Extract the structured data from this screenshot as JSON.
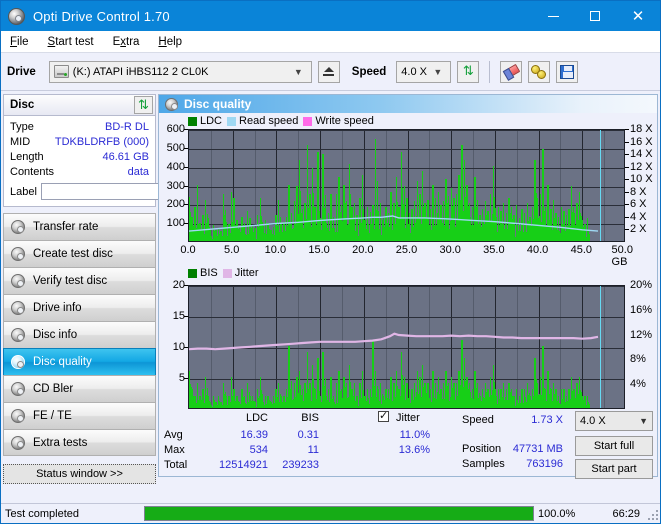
{
  "window": {
    "title": "Opti Drive Control 1.70",
    "icon": "disc-icon",
    "minimize": "−",
    "maximize": "□",
    "close": "✕"
  },
  "menu": [
    {
      "label": "File",
      "accel": "F"
    },
    {
      "label": "Start test",
      "accel": "S"
    },
    {
      "label": "Extra",
      "accel": "x"
    },
    {
      "label": "Help",
      "accel": "H"
    }
  ],
  "toolbar": {
    "drive_label": "Drive",
    "drive_value": "(K:)  ATAPI iHBS112  2 CL0K",
    "drive_icon": "drive-icon",
    "eject_icon": "eject-icon",
    "speed_label": "Speed",
    "speed_value": "4.0 X",
    "refresh_icon": "refresh-icon",
    "eraser_icon": "eraser-icon",
    "keys_icon": "keys-icon",
    "save_icon": "save-floppy-icon"
  },
  "disc_panel": {
    "header": "Disc",
    "refresh_icon": "refresh-icon",
    "rows": [
      {
        "key": "Type",
        "value": "BD-R DL"
      },
      {
        "key": "MID",
        "value": "TDKBLDRFB (000)"
      },
      {
        "key": "Length",
        "value": "46.61 GB"
      },
      {
        "key": "Contents",
        "value": "data"
      }
    ],
    "label_key": "Label",
    "label_value": "",
    "label_placeholder": "",
    "disc_button_icon": "cd-icon"
  },
  "nav": {
    "items": [
      {
        "label": "Transfer rate",
        "icon": "disc-icon",
        "selected": false
      },
      {
        "label": "Create test disc",
        "icon": "disc-icon",
        "selected": false
      },
      {
        "label": "Verify test disc",
        "icon": "disc-icon",
        "selected": false
      },
      {
        "label": "Drive info",
        "icon": "disc-icon",
        "selected": false
      },
      {
        "label": "Disc info",
        "icon": "disc-icon",
        "selected": false
      },
      {
        "label": "Disc quality",
        "icon": "disc-icon",
        "selected": true
      },
      {
        "label": "CD Bler",
        "icon": "disc-icon",
        "selected": false
      },
      {
        "label": "FE / TE",
        "icon": "disc-icon",
        "selected": false
      },
      {
        "label": "Extra tests",
        "icon": "disc-icon",
        "selected": false
      }
    ],
    "status_window": "Status window >>"
  },
  "panel": {
    "title": "Disc quality",
    "icon": "disc-icon"
  },
  "stats": {
    "col_ldc": "LDC",
    "col_bis": "BIS",
    "jitter_label": "Jitter",
    "jitter_checked": true,
    "rows": [
      {
        "name": "Avg",
        "ldc": "16.39",
        "bis": "0.31",
        "jitter": "11.0%"
      },
      {
        "name": "Max",
        "ldc": "534",
        "bis": "11",
        "jitter": "13.6%"
      },
      {
        "name": "Total",
        "ldc": "12514921",
        "bis": "239233",
        "jitter": ""
      }
    ],
    "speed_label": "Speed",
    "speed_value": "1.73 X",
    "position_label": "Position",
    "position_value": "47731 MB",
    "samples_label": "Samples",
    "samples_value": "763196",
    "speed_select": "4.0 X",
    "start_full": "Start full",
    "start_part": "Start part"
  },
  "statusbar": {
    "message": "Test completed",
    "progress_percent": 100,
    "progress_text": "100.0%",
    "elapsed": "66:29"
  },
  "colors": {
    "accent": "#0a84d8",
    "ldc_green": "#17cf17",
    "read_speed": "#9fd8f2",
    "write_speed": "#ff6be8",
    "jitter_pink": "#e0b6e6",
    "plot_bg": "#6b7285",
    "progress_green": "#16ac16",
    "value_blue": "#2b2bd4"
  },
  "chart_data": [
    {
      "type": "bar",
      "name": "disc-quality-ldc-chart",
      "title": "",
      "xlabel": "GB",
      "ylabel": "LDC",
      "xlim": [
        0,
        50
      ],
      "ylim": [
        0,
        600
      ],
      "y2lim": [
        0,
        18
      ],
      "y2label": "X",
      "grid": true,
      "legend_position": "top-left",
      "legend": [
        {
          "name": "LDC",
          "color": "#008000"
        },
        {
          "name": "Read speed",
          "color": "#9fd8f2"
        },
        {
          "name": "Write speed",
          "color": "#ff6be8"
        }
      ],
      "xticks": [
        "0.0",
        "5.0",
        "10.0",
        "15.0",
        "20.0",
        "25.0",
        "30.0",
        "35.0",
        "40.0",
        "45.0",
        "50.0 GB"
      ],
      "yticks": [
        "100",
        "200",
        "300",
        "400",
        "500",
        "600"
      ],
      "y2ticks": [
        "2 X",
        "4 X",
        "6 X",
        "8 X",
        "10 X",
        "12 X",
        "14 X",
        "16 X",
        "18 X"
      ],
      "data_end_gb": 47.0,
      "series": [
        {
          "name": "LDC",
          "color": "#17cf17",
          "kind": "bars",
          "x": [
            0.0,
            0.3,
            0.6,
            0.9,
            1.2,
            1.5,
            1.8,
            2.1,
            2.4,
            2.7,
            3.0,
            3.3,
            3.6,
            3.9,
            4.2,
            4.5,
            4.8,
            5.1,
            5.4,
            5.7,
            6.0,
            6.3,
            6.6,
            6.9,
            7.2,
            7.5,
            7.8,
            8.1,
            8.4,
            8.7,
            9.0,
            9.3,
            9.6,
            9.9,
            10.2,
            10.5,
            10.8,
            11.1,
            11.4,
            11.7,
            12.0,
            12.3,
            12.6,
            12.9,
            13.2,
            13.5,
            13.8,
            14.1,
            14.4,
            14.7,
            15.0,
            15.3,
            15.6,
            15.9,
            16.2,
            16.5,
            16.8,
            17.1,
            17.4,
            17.7,
            18.0,
            18.3,
            18.6,
            18.9,
            19.2,
            19.5,
            19.8,
            20.1,
            20.4,
            20.7,
            21.0,
            21.3,
            21.6,
            21.9,
            22.2,
            22.5,
            22.8,
            23.1,
            23.4,
            23.7,
            24.0,
            24.3,
            24.6,
            24.9,
            25.2,
            25.5,
            25.8,
            26.1,
            26.4,
            26.7,
            27.0,
            27.3,
            27.6,
            27.9,
            28.2,
            28.5,
            28.8,
            29.1,
            29.4,
            29.7,
            30.0,
            30.3,
            30.6,
            30.9,
            31.2,
            31.5,
            31.8,
            32.1,
            32.4,
            32.7,
            33.0,
            33.3,
            33.6,
            33.9,
            34.2,
            34.5,
            34.8,
            35.1,
            35.4,
            35.7,
            36.0,
            36.3,
            36.6,
            36.9,
            37.2,
            37.5,
            37.8,
            38.1,
            38.4,
            38.7,
            39.0,
            39.3,
            39.6,
            39.9,
            40.2,
            40.5,
            40.8,
            41.1,
            41.4,
            41.7,
            42.0,
            42.3,
            42.6,
            42.9,
            43.2,
            43.5,
            43.8,
            44.1,
            44.4,
            44.7,
            45.0,
            45.3,
            45.6,
            45.9,
            46.2,
            46.5,
            46.8
          ],
          "values": [
            235,
            130,
            180,
            300,
            95,
            140,
            220,
            120,
            65,
            85,
            60,
            70,
            55,
            250,
            100,
            90,
            260,
            230,
            110,
            75,
            130,
            95,
            160,
            120,
            85,
            70,
            140,
            230,
            80,
            110,
            95,
            60,
            75,
            140,
            220,
            90,
            100,
            130,
            300,
            150,
            210,
            290,
            430,
            170,
            200,
            510,
            250,
            390,
            180,
            470,
            120,
            460,
            200,
            150,
            250,
            130,
            250,
            340,
            190,
            300,
            210,
            410,
            180,
            200,
            140,
            230,
            350,
            110,
            180,
            155,
            190,
            540,
            160,
            200,
            120,
            180,
            150,
            260,
            200,
            340,
            180,
            470,
            290,
            230,
            150,
            170,
            210,
            320,
            250,
            370,
            200,
            220,
            170,
            300,
            230,
            260,
            190,
            210,
            330,
            240,
            280,
            230,
            250,
            350,
            510,
            430,
            300,
            200,
            180,
            340,
            220,
            140,
            170,
            210,
            160,
            250,
            400,
            130,
            180,
            160,
            200,
            150,
            230,
            180,
            140,
            190,
            120,
            170,
            150,
            200,
            130,
            180,
            430,
            230,
            250,
            490,
            180,
            300,
            170,
            220,
            150,
            130,
            180,
            160,
            140,
            170,
            290,
            150,
            200,
            260,
            110,
            90,
            120
          ],
          "note": "Per-sample LDC error counts across the recorded area (0 to 47 GB)"
        },
        {
          "name": "Read speed",
          "color": "#9fd8f2",
          "kind": "line",
          "axis": "right",
          "x": [
            0.0,
            2.5,
            5.0,
            7.5,
            10.0,
            12.5,
            15.0,
            17.5,
            20.0,
            21.0,
            22.0,
            23.3,
            24.0,
            25.0,
            27.0,
            30.0,
            32.5,
            35.0,
            37.5,
            40.0,
            42.5,
            45.0,
            46.8
          ],
          "values": [
            1.9,
            2.2,
            2.5,
            2.8,
            3.1,
            3.3,
            3.6,
            3.8,
            4.0,
            4.1,
            4.1,
            4.3,
            4.0,
            4.0,
            4.0,
            3.8,
            3.6,
            3.4,
            3.1,
            2.8,
            2.5,
            2.1,
            1.9
          ],
          "note": "Read speed in X, right axis"
        },
        {
          "name": "Write speed",
          "color": "#ff6be8",
          "kind": "line",
          "axis": "right",
          "x": [],
          "values": []
        }
      ]
    },
    {
      "type": "bar",
      "name": "disc-quality-bis-jitter-chart",
      "title": "",
      "xlabel": "GB",
      "ylabel": "BIS",
      "xlim": [
        0,
        50
      ],
      "ylim": [
        0,
        20
      ],
      "y2lim": [
        0,
        20
      ],
      "y2label": "%",
      "grid": true,
      "legend_position": "top-left",
      "legend": [
        {
          "name": "BIS",
          "color": "#008000"
        },
        {
          "name": "Jitter",
          "color": "#e0b6e6"
        }
      ],
      "xticks": [
        "0.0",
        "5.0",
        "10.0",
        "15.0",
        "20.0",
        "25.0",
        "30.0",
        "35.0",
        "40.0",
        "45.0",
        "50.0 GB"
      ],
      "yticks": [
        "5",
        "10",
        "15",
        "20"
      ],
      "y2ticks": [
        "4%",
        "8%",
        "12%",
        "16%",
        "20%"
      ],
      "data_end_gb": 47.0,
      "series": [
        {
          "name": "BIS",
          "color": "#17cf17",
          "kind": "bars",
          "x": [
            0.0,
            0.3,
            0.6,
            0.9,
            1.2,
            1.5,
            1.8,
            2.1,
            2.4,
            2.7,
            3.0,
            3.3,
            3.6,
            3.9,
            4.2,
            4.5,
            4.8,
            5.1,
            5.4,
            5.7,
            6.0,
            6.3,
            6.6,
            6.9,
            7.2,
            7.5,
            7.8,
            8.1,
            8.4,
            8.7,
            9.0,
            9.3,
            9.6,
            9.9,
            10.2,
            10.5,
            10.8,
            11.1,
            11.4,
            11.7,
            12.0,
            12.3,
            12.6,
            12.9,
            13.2,
            13.5,
            13.8,
            14.1,
            14.4,
            14.7,
            15.0,
            15.3,
            15.6,
            15.9,
            16.2,
            16.5,
            16.8,
            17.1,
            17.4,
            17.7,
            18.0,
            18.3,
            18.6,
            18.9,
            19.2,
            19.5,
            19.8,
            20.1,
            20.4,
            20.7,
            21.0,
            21.3,
            21.6,
            21.9,
            22.2,
            22.5,
            22.8,
            23.1,
            23.4,
            23.7,
            24.0,
            24.3,
            24.6,
            24.9,
            25.2,
            25.5,
            25.8,
            26.1,
            26.4,
            26.7,
            27.0,
            27.3,
            27.6,
            27.9,
            28.2,
            28.5,
            28.8,
            29.1,
            29.4,
            29.7,
            30.0,
            30.3,
            30.6,
            30.9,
            31.2,
            31.5,
            31.8,
            32.1,
            32.4,
            32.7,
            33.0,
            33.3,
            33.6,
            33.9,
            34.2,
            34.5,
            34.8,
            35.1,
            35.4,
            35.7,
            36.0,
            36.3,
            36.6,
            36.9,
            37.2,
            37.5,
            37.8,
            38.1,
            38.4,
            38.7,
            39.0,
            39.3,
            39.6,
            39.9,
            40.2,
            40.5,
            40.8,
            41.1,
            41.4,
            41.7,
            42.0,
            42.3,
            42.6,
            42.9,
            43.2,
            43.5,
            43.8,
            44.1,
            44.4,
            44.7,
            45.0,
            45.3,
            45.6,
            45.9,
            46.2,
            46.5,
            46.8
          ],
          "values": [
            6,
            3,
            2,
            4,
            2,
            3,
            5,
            2,
            1,
            2,
            1,
            2,
            1,
            4,
            2,
            2,
            5,
            3,
            2,
            1,
            3,
            2,
            4,
            2,
            2,
            1,
            3,
            5,
            1,
            2,
            2,
            1,
            2,
            3,
            4,
            2,
            2,
            3,
            10,
            3,
            4,
            5,
            6,
            3,
            4,
            9,
            4,
            7,
            3,
            8,
            2,
            9,
            4,
            3,
            5,
            2,
            4,
            6,
            3,
            5,
            4,
            7,
            3,
            4,
            2,
            4,
            6,
            2,
            3,
            3,
            11,
            6,
            3,
            4,
            2,
            3,
            3,
            5,
            4,
            6,
            3,
            9,
            5,
            4,
            3,
            3,
            4,
            6,
            5,
            7,
            4,
            4,
            3,
            6,
            4,
            5,
            3,
            4,
            6,
            4,
            5,
            4,
            4,
            6,
            11,
            8,
            5,
            4,
            3,
            6,
            4,
            2,
            3,
            4,
            3,
            5,
            7,
            2,
            3,
            3,
            4,
            3,
            4,
            3,
            2,
            3,
            2,
            3,
            3,
            4,
            2,
            3,
            8,
            4,
            5,
            10,
            3,
            6,
            3,
            4,
            3,
            2,
            3,
            3,
            2,
            3,
            5,
            3,
            4,
            5,
            2,
            2,
            2
          ],
          "note": "Per-sample BIS error counts across the recorded area (0 to 47 GB)"
        },
        {
          "name": "Jitter",
          "color": "#e0b6e6",
          "kind": "line",
          "axis": "right",
          "x": [
            0.0,
            1.0,
            2.0,
            3.0,
            4.0,
            5.0,
            6.0,
            7.0,
            8.0,
            9.0,
            10.0,
            11.0,
            12.0,
            13.0,
            14.0,
            15.0,
            16.0,
            17.0,
            18.0,
            19.0,
            20.0,
            21.0,
            22.0,
            23.0,
            23.5,
            24.0,
            25.0,
            26.0,
            27.0,
            28.0,
            29.0,
            30.0,
            31.0,
            32.0,
            33.0,
            34.0,
            35.0,
            36.0,
            37.0,
            38.0,
            39.0,
            40.0,
            41.0,
            42.0,
            43.0,
            44.0,
            45.0,
            46.0,
            46.8
          ],
          "values": [
            9.8,
            9.9,
            9.9,
            9.8,
            9.9,
            10.0,
            10.1,
            10.2,
            10.3,
            10.4,
            10.5,
            10.6,
            10.7,
            10.8,
            10.9,
            11.0,
            11.0,
            11.0,
            11.0,
            11.0,
            11.1,
            11.2,
            11.4,
            11.9,
            12.3,
            12.1,
            12.0,
            11.9,
            11.9,
            11.9,
            11.9,
            12.0,
            11.9,
            12.0,
            11.9,
            11.9,
            11.8,
            11.7,
            11.7,
            11.6,
            11.6,
            11.6,
            11.6,
            11.6,
            11.6,
            11.6,
            11.5,
            11.6,
            11.8
          ],
          "note": "Jitter percentage, right axis"
        }
      ]
    }
  ]
}
